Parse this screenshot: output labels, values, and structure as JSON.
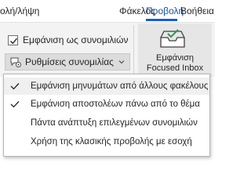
{
  "ribbon": {
    "tabs": [
      {
        "label": "ολή/λήψη"
      },
      {
        "label": "Φάκελος"
      },
      {
        "label": "Προβολή"
      },
      {
        "label": "Βοήθεια"
      }
    ],
    "active_tab_color": "#1b5fb4",
    "show_as_conversations": {
      "label": "Εμφάνιση ως συνομιλιών",
      "checked": true
    },
    "conversation_settings": {
      "label": "Ρυθμίσεις συνομιλίας",
      "icon": "conversation-settings-icon"
    },
    "focused_inbox": {
      "line1": "Εμφάνιση",
      "line2": "Focused Inbox",
      "icon": "inbox-check-icon"
    }
  },
  "menu": {
    "items": [
      {
        "label": "Εμφάνιση μηνυμάτων από άλλους φακέλους",
        "checked": true
      },
      {
        "label": "Εμφάνιση αποστολέων πάνω από το θέμα",
        "checked": true
      },
      {
        "label": "Πάντα ανάπτυξη επιλεγμένων συνομιλιών",
        "checked": false
      },
      {
        "label": "Χρήση της κλασικής προβολής με εσοχή",
        "checked": false
      }
    ]
  }
}
